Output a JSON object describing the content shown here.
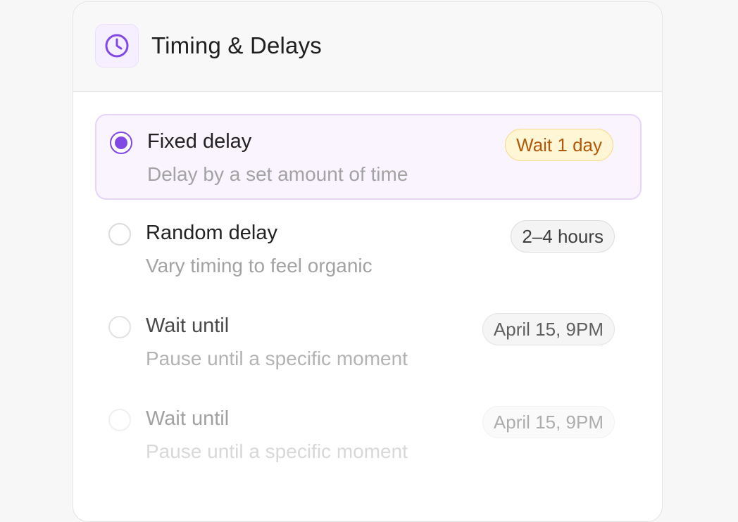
{
  "panel": {
    "title": "Timing & Delays",
    "icon": "clock-icon",
    "accent_color": "#8248e6"
  },
  "options": [
    {
      "title": "Fixed delay",
      "description": "Delay by a set amount of time",
      "badge": "Wait 1 day",
      "selected": true
    },
    {
      "title": "Random delay",
      "description": "Vary timing to feel organic",
      "badge": "2–4 hours",
      "selected": false
    },
    {
      "title": "Wait until",
      "description": "Pause until a specific moment",
      "badge": "April 15, 9PM",
      "selected": false
    },
    {
      "title": "Wait until",
      "description": "Pause until a specific moment",
      "badge": "April 15, 9PM",
      "selected": false
    }
  ]
}
